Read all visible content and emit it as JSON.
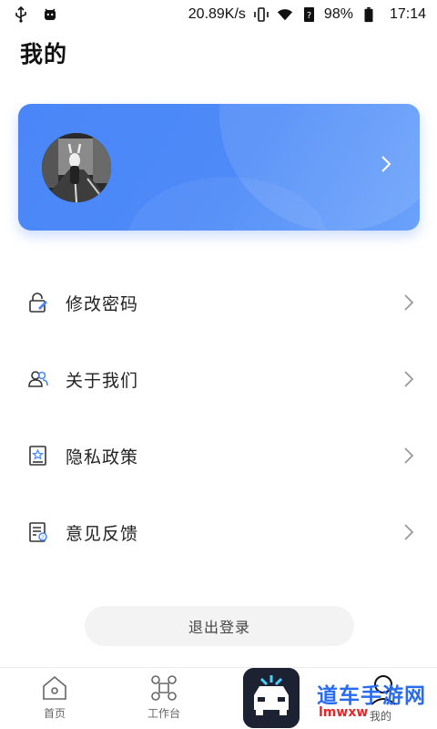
{
  "status_bar": {
    "speed": "20.89K/s",
    "battery": "98%",
    "time": "17:14"
  },
  "header": {
    "title": "我的"
  },
  "menu": [
    {
      "label": "修改密码",
      "icon": "edit-lock-icon"
    },
    {
      "label": "关于我们",
      "icon": "users-icon"
    },
    {
      "label": "隐私政策",
      "icon": "policy-document-icon"
    },
    {
      "label": "意见反馈",
      "icon": "feedback-icon"
    }
  ],
  "logout": {
    "label": "退出登录"
  },
  "bottom_nav": [
    {
      "label": "首页",
      "icon": "home-icon"
    },
    {
      "label": "工作台",
      "icon": "command-icon"
    },
    {
      "label": "我的",
      "icon": "profile-icon"
    }
  ],
  "watermark": {
    "text": "道车手游网",
    "sub": "lmwxw"
  },
  "colors": {
    "accent": "#4a86f7",
    "watermark_blue": "#2a6cf0",
    "watermark_red": "#e4262b"
  }
}
